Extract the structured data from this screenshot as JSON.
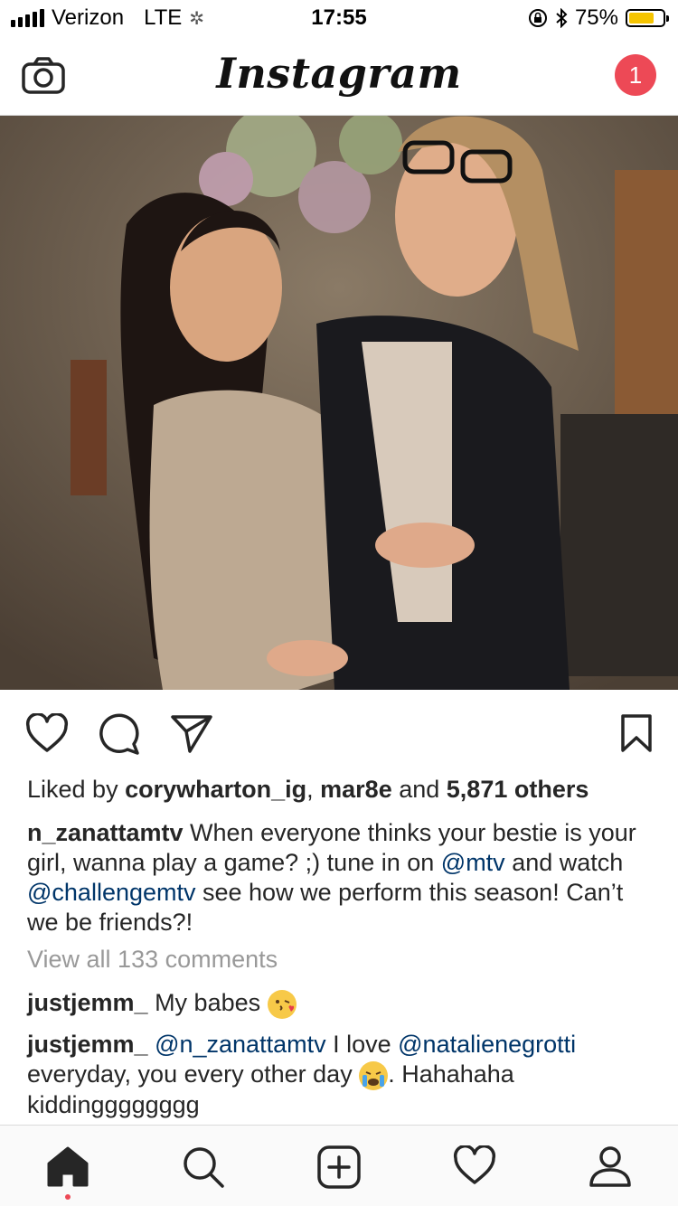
{
  "status_bar": {
    "carrier": "Verizon",
    "network": "LTE",
    "time": "17:55",
    "battery_percent": "75%",
    "battery_level": 0.75
  },
  "nav": {
    "logo": "Instagram",
    "notification_count": "1"
  },
  "post": {
    "likes": {
      "prefix": "Liked by ",
      "user1": "corywharton_ig",
      "sep": ", ",
      "user2": "mar8e",
      "and": " and ",
      "others": "5,871 others"
    },
    "caption": {
      "username": "n_zanattamtv",
      "text1": " When everyone thinks your bestie is your girl, wanna play a game? ;) tune in on ",
      "mention1": "@mtv",
      "text2": " and watch ",
      "mention2": "@challengemtv",
      "text3": "  see how we perform this season!  Can’t we be friends?!"
    },
    "view_all_comments": "View all 133 comments",
    "comments": [
      {
        "username": "justjemm_",
        "text": " My babes "
      },
      {
        "username": "justjemm_",
        "mention1": "@n_zanattamtv",
        "text1": " I love ",
        "mention2": "@natalienegrotti",
        "text2": " everyday, you every other day ",
        "text3": ". Hahahaha kiddingggggggg"
      }
    ]
  },
  "icons": {
    "camera": "camera-icon",
    "like": "heart-icon",
    "comment": "comment-icon",
    "share": "send-icon",
    "save": "bookmark-icon",
    "home": "home-icon",
    "search": "search-icon",
    "add": "add-post-icon",
    "activity": "heart-icon",
    "profile": "profile-icon"
  },
  "colors": {
    "link": "#003569",
    "badge": "#ed4956",
    "battery": "#f5c400"
  }
}
